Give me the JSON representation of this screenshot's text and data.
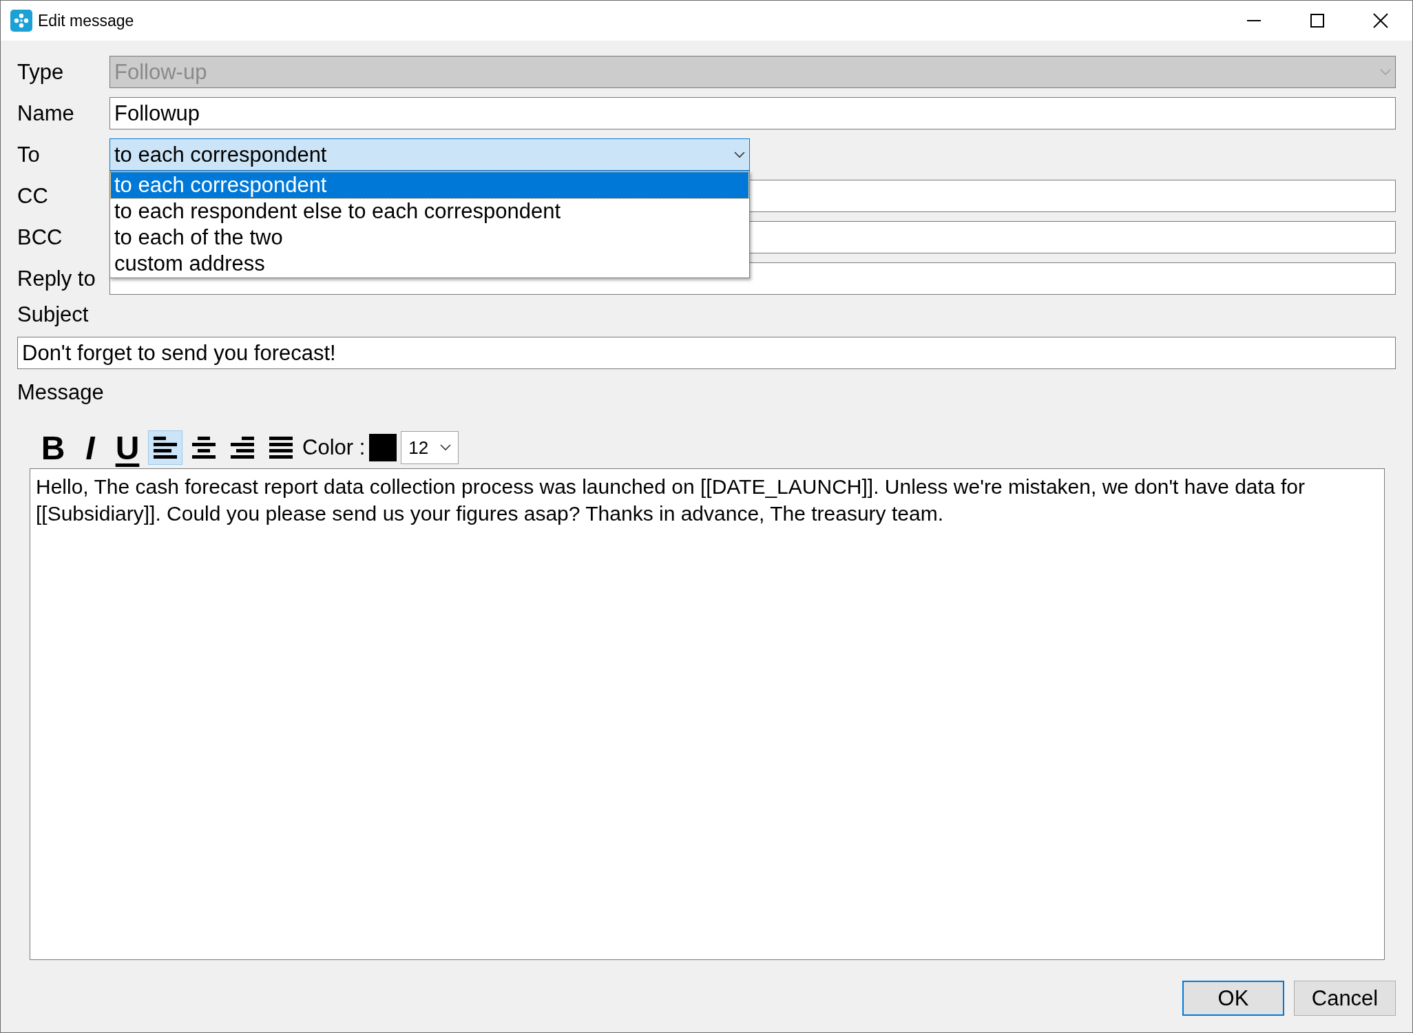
{
  "window": {
    "title": "Edit message"
  },
  "fields": [
    {
      "label": "Type",
      "kind": "select",
      "value": "Follow-up",
      "disabled": true,
      "expanded": false
    },
    {
      "label": "Name",
      "kind": "text",
      "value": "Followup",
      "disabled": false
    },
    {
      "label": "To",
      "kind": "select",
      "value": "to each correspondent",
      "disabled": false,
      "expanded": true,
      "options": [
        {
          "label": "to each correspondent",
          "selected": true
        },
        {
          "label": "to each respondent else to each correspondent",
          "selected": false
        },
        {
          "label": "to each of the two",
          "selected": false
        },
        {
          "label": "custom address",
          "selected": false
        }
      ]
    },
    {
      "label": "CC",
      "kind": "text",
      "disabled": false
    },
    {
      "label": "BCC",
      "kind": "text",
      "disabled": false
    },
    {
      "label": "Reply to",
      "kind": "text",
      "disabled": false
    }
  ],
  "subject": {
    "label": "Subject",
    "value": "Don't forget to send you forecast!"
  },
  "message": {
    "label": "Message",
    "format_buttons": [
      {
        "label": "B",
        "kind": "bold"
      },
      {
        "label": "I",
        "kind": "italic"
      },
      {
        "label": "U",
        "kind": "underline"
      }
    ],
    "alignments": [
      {
        "kind": "left",
        "selected": true
      },
      {
        "kind": "center",
        "selected": false
      },
      {
        "kind": "right",
        "selected": false
      },
      {
        "kind": "justify",
        "selected": false
      }
    ],
    "color_label": "Color :",
    "color": "#000000",
    "font_size": "12",
    "body": "Hello, The cash forecast report data collection process was launched on [[DATE_LAUNCH]]. Unless we're mistaken, we don't have data for [[Subsidiary]]. Could you please send us your figures asap? Thanks in advance, The treasury team."
  },
  "buttons": [
    {
      "label": "OK",
      "default": true
    },
    {
      "label": "Cancel",
      "default": false
    }
  ]
}
